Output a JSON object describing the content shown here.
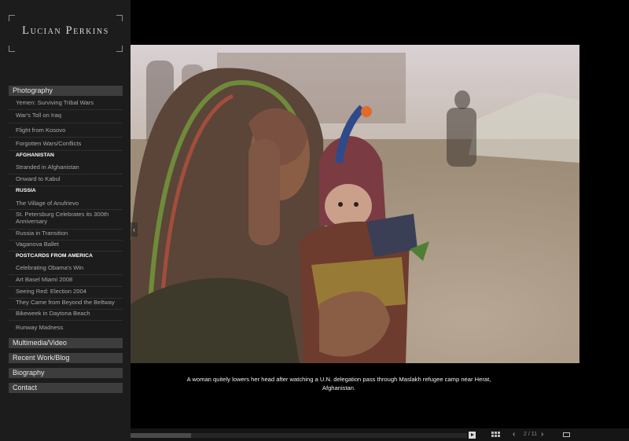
{
  "site": {
    "title": "Lucian Perkins"
  },
  "nav": {
    "photography": "Photography",
    "multimedia": "Multimedia/Video",
    "recent": "Recent Work/Blog",
    "biography": "Biography",
    "contact": "Contact"
  },
  "submenu": {
    "items_top": [
      "Yemen: Surviving Tribal Wars",
      "War's Toll on Iraq",
      "Flight from Kosovo",
      "Forgotten Wars/Conflicts"
    ],
    "afghanistan": {
      "heading": "AFGHANISTAN",
      "items": [
        "Stranded in Afghanistan",
        "Onward to Kabul"
      ]
    },
    "russia": {
      "heading": "RUSSIA",
      "items": [
        "The Village of Anufrievo",
        "St. Petersburg Celebrates its 300th Anniversary",
        "Russia in Transition",
        "Vaganova Ballet"
      ]
    },
    "america": {
      "heading": "POSTCARDS FROM AMERICA",
      "items": [
        "Celebrating Obama's Win",
        "Art Basel Miami 2008",
        "Seeing Red: Election 2004",
        "They Came from Beyond the Beltway",
        "Bikeweek in Daytona Beach",
        "Runway Madness"
      ]
    }
  },
  "caption": "A woman quitely lowers her head after watching a U.N. delegation pass through Maslakh refugee camp near Herat, Afghanistan.",
  "viewer": {
    "counter": "2 / 11",
    "progress": 0.18,
    "icons": [
      "play-icon",
      "grid-icon",
      "prev-arrow-icon",
      "next-arrow-icon",
      "caption-toggle-icon"
    ]
  },
  "colors": {
    "sidebar_bg": "#1c1c1c",
    "section_bg": "#3d3d3d",
    "page_bg": "#000000"
  }
}
